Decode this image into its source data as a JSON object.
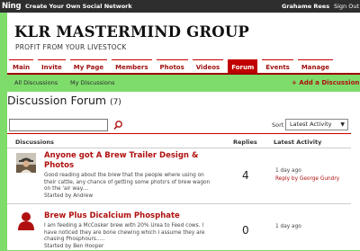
{
  "topbar": {
    "brand": "Ning",
    "create": "Create Your Own Social Network",
    "user": "Grahame Rees",
    "signout": "Sign Out"
  },
  "site": {
    "title": "KLR MASTERMIND GROUP",
    "subtitle": "PROFIT FROM YOUR LIVESTOCK"
  },
  "nav": {
    "items": [
      "Main",
      "Invite",
      "My Page",
      "Members",
      "Photos",
      "Videos",
      "Forum",
      "Events",
      "Manage"
    ],
    "active": "Forum"
  },
  "subnav": {
    "all": "All Discussions",
    "mine": "My Discussions",
    "add": "+ Add a Discussion"
  },
  "forum": {
    "title": "Discussion Forum",
    "count": "(7)",
    "search_placeholder": "",
    "sort_label": "Sort by:",
    "sort_value": "Latest Activity"
  },
  "table": {
    "headers": {
      "discussions": "Discussions",
      "replies": "Replies",
      "latest": "Latest Activity"
    },
    "rows": [
      {
        "title_l1": "Anyone got A Brew Trailer Design &",
        "title_l2": "Photos",
        "body_l1": "Good reading about the brew that the people where using on",
        "body_l2": "their cattle, any chance of getting some photo's of brew wagon",
        "body_l3": "on the 'air way....",
        "started": "Started by Andrew",
        "replies": "4",
        "ago": "1 day ago",
        "reply_by": "Reply by George Gundry",
        "avatar": "profile-photo"
      },
      {
        "title_l1": "Brew Plus Dicalcium Phosphate",
        "body_l1": "I am feeding a McCosker brew with 20% Urea to Feed cows. I",
        "body_l2": "have noticed they are bone chewing which I assume they are",
        "body_l3": "chasing Phosphours.....",
        "started": "Started by Ben Hooper",
        "replies": "0",
        "ago": "1 day ago",
        "avatar": "default-silhouette"
      }
    ]
  },
  "colors": {
    "accent": "#c00000",
    "background": "#7edc6b",
    "topbar": "#2e2e2e"
  }
}
